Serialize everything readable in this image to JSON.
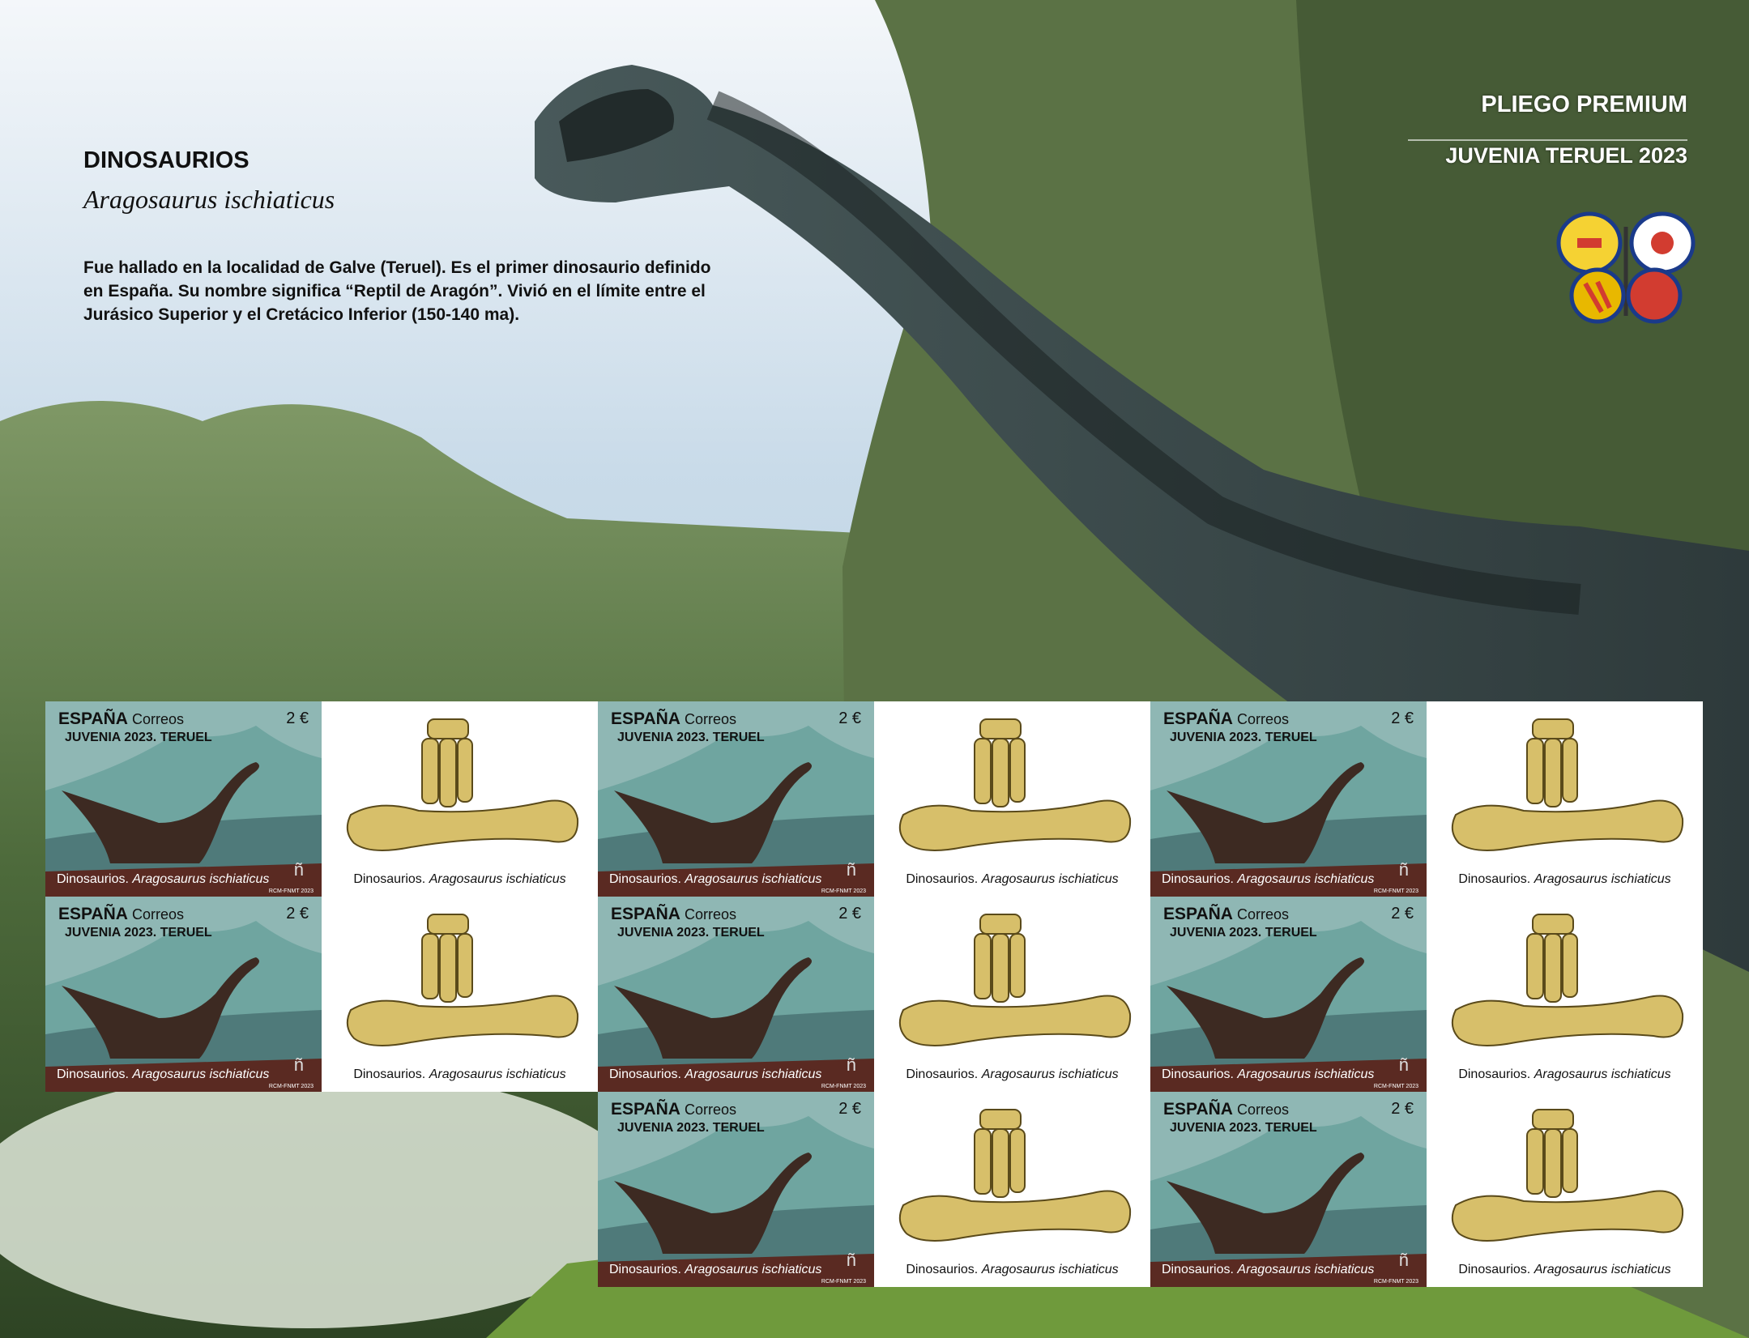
{
  "header": {
    "title": "DINOSAURIOS",
    "species": "Aragosaurus ischiaticus",
    "description": "Fue hallado en la localidad de Galve (Teruel). Es el primer dinosaurio definido en España. Su nombre significa “Reptil de Aragón”. Vivió en el límite entre el Jurásico Superior y el Cretácico Inferior (150-140 ma).",
    "badge_top": "PLIEGO PREMIUM",
    "badge_bottom": "JUVENIA TERUEL 2023"
  },
  "stamp": {
    "country": "ESPAÑA",
    "service": "Correos",
    "value": "2 €",
    "event": "JUVENIA 2023. TERUEL",
    "caption_prefix": "Dinosaurios.",
    "caption_species": "Aragosaurus ischiaticus",
    "printer": "RCM-FNMT 2023",
    "mark": "ñ"
  },
  "label": {
    "caption_prefix": "Dinosaurios.",
    "caption_species": "Aragosaurus ischiaticus"
  },
  "colors": {
    "sky": "#a9c4dc",
    "foliage": "#5f7a3e",
    "dino": "#3d4e50",
    "stamp_ground": "#5a2a22",
    "bone": "#d7bf6a"
  }
}
